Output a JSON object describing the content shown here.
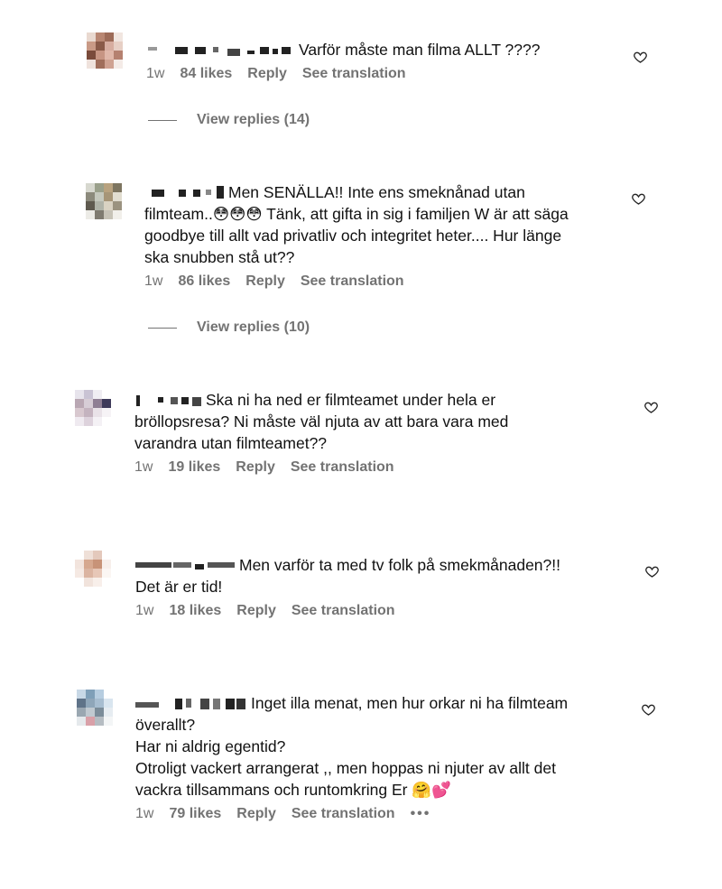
{
  "comments": [
    {
      "text": "Varför måste man filma ALLT ????",
      "time": "1w",
      "likes": "84 likes",
      "reply": "Reply",
      "translate": "See translation",
      "view_replies": "View replies (14)"
    },
    {
      "text": "Men SENÄLLA!! Inte ens smeknånad utan\nfilmteam..😳😳😳 Tänk, att gifta in sig i familjen W är att säga\ngoodbye till allt vad privatliv och integritet heter.... Hur länge\nska snubben stå ut??",
      "time": "1w",
      "likes": "86 likes",
      "reply": "Reply",
      "translate": "See translation",
      "view_replies": "View replies (10)"
    },
    {
      "text": "Ska ni ha ned er filmteamet under hela er\nbröllopsresa? Ni måste väl njuta av att bara vara med\nvarandra utan filmteamet??",
      "time": "1w",
      "likes": "19 likes",
      "reply": "Reply",
      "translate": "See translation"
    },
    {
      "text": "Men varför ta med tv folk på smekmånaden?!!\nDet är er tid!",
      "time": "1w",
      "likes": "18 likes",
      "reply": "Reply",
      "translate": "See translation"
    },
    {
      "text": "Inget illa menat, men hur orkar ni ha filmteam\növerallt?\nHar ni aldrig egentid?\nOtroligt vackert arrangerat ,, men hoppas ni njuter av allt det\nvackra tillsammans och runtomkring Er 🤗💕",
      "time": "1w",
      "likes": "79 likes",
      "reply": "Reply",
      "translate": "See translation",
      "more": "•••"
    }
  ],
  "icons": {
    "heart": "heart-outline-icon",
    "more": "more-options-icon"
  },
  "colors": {
    "muted": "#737373",
    "text": "#111111"
  }
}
